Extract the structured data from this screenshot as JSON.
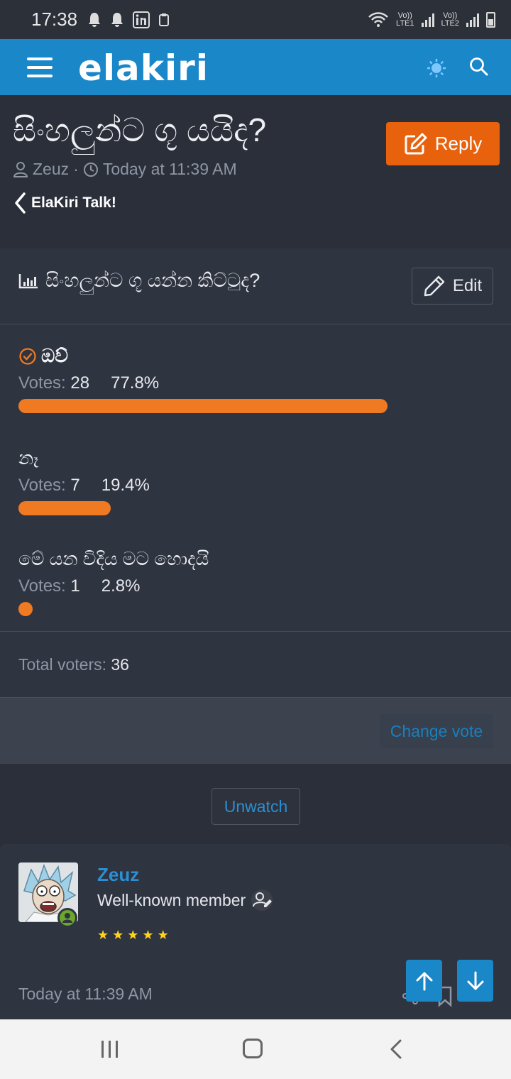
{
  "status_bar": {
    "time": "17:38",
    "lte1": "LTE1",
    "lte2": "LTE2",
    "volte": "Vo))"
  },
  "header": {
    "logo": "elakiri"
  },
  "thread": {
    "title": "සිංහලුන්ට ගූ යයිද?",
    "author": "Zeuz",
    "separator": "·",
    "date": "Today at 11:39 AM",
    "breadcrumb": "ElaKiri Talk!",
    "reply_label": "Reply"
  },
  "poll": {
    "question": "සිංහලුන්ට ගූ යන්න කිට්ටුද?",
    "edit_label": "Edit",
    "votes_prefix": "Votes:",
    "options": [
      {
        "label": "ඔව්",
        "votes": "28",
        "percent": "77.8%",
        "fraction": 0.778,
        "voted": true
      },
      {
        "label": "නෑ",
        "votes": "7",
        "percent": "19.4%",
        "fraction": 0.194,
        "voted": false
      },
      {
        "label": "මේ යන විදිය මට හොදයි",
        "votes": "1",
        "percent": "2.8%",
        "fraction": 0.028,
        "voted": false
      }
    ],
    "total_label": "Total voters:",
    "total": "36",
    "change_vote_label": "Change vote"
  },
  "unwatch_label": "Unwatch",
  "post": {
    "username": "Zeuz",
    "user_title": "Well-known member",
    "stars": 5,
    "time": "Today at 11:39 AM"
  },
  "colors": {
    "header": "#1a87c9",
    "accent": "#e8620e",
    "bar": "#f07a22",
    "link": "#2b8fd3",
    "background": "#2a2f3a"
  }
}
